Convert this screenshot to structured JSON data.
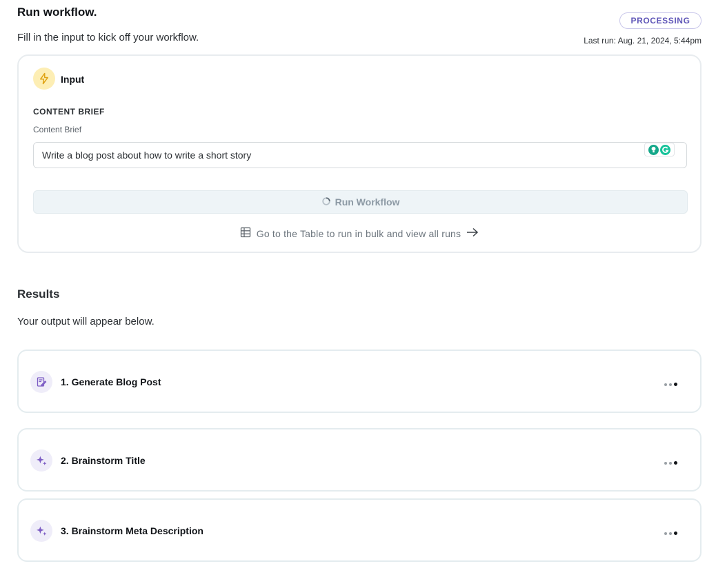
{
  "header": {
    "title": "Run workflow.",
    "subtitle": "Fill in the input to kick off your workflow.",
    "status": "PROCESSING",
    "last_run": "Last run: Aug. 21, 2024, 5:44pm"
  },
  "input_card": {
    "title": "Input",
    "field_heading": "CONTENT BRIEF",
    "field_label": "Content Brief",
    "field_value": "Write a blog post about how to write a short story",
    "run_button_label": "Run Workflow",
    "table_link_label": "Go to the Table to run in bulk and view all runs"
  },
  "results": {
    "title": "Results",
    "subtitle": "Your output will appear below.",
    "steps": [
      {
        "label": "1. Generate Blog Post",
        "icon": "document-edit-icon"
      },
      {
        "label": "2. Brainstorm Title",
        "icon": "sparkle-icon"
      },
      {
        "label": "3. Brainstorm Meta Description",
        "icon": "sparkle-icon"
      }
    ]
  },
  "colors": {
    "accent": "#5f56b8",
    "input_icon_bg": "#fdeeb4",
    "step_icon_bg": "#efedf9",
    "grammarly_green": "#15c39a"
  }
}
